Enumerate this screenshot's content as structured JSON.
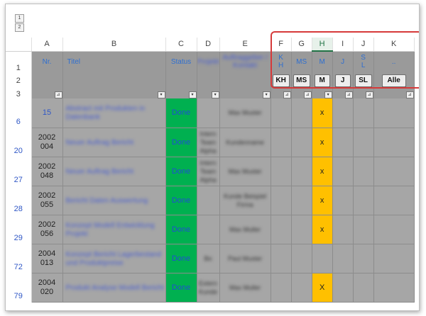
{
  "outline_buttons": [
    "1",
    "2"
  ],
  "columns": [
    {
      "letter": "A"
    },
    {
      "letter": "B"
    },
    {
      "letter": "C"
    },
    {
      "letter": "D"
    },
    {
      "letter": "E"
    },
    {
      "letter": "F"
    },
    {
      "letter": "G"
    },
    {
      "letter": "H"
    },
    {
      "letter": "I"
    },
    {
      "letter": "J"
    },
    {
      "letter": "K"
    }
  ],
  "header_row": {
    "row_num": "1",
    "nr": "Nr.",
    "titel": "Titel",
    "status": "Status",
    "d_label_blurred": "Projekt",
    "e_label_blurred": "Auftraggeber / Kontakt",
    "f_label": "K\nH",
    "g_label": "MS",
    "h_label": "M",
    "i_label": "J",
    "j_label": "S\nL",
    "k_label": ".."
  },
  "button_row": {
    "row_num": "2",
    "buttons": [
      "KH",
      "MS",
      "M",
      "J",
      "SL",
      "Alle"
    ]
  },
  "filter_row": {
    "row_num": "3"
  },
  "rows": [
    {
      "row_num": "6",
      "nr": "15",
      "titel": "Abstract mit Produkten in Datenbank",
      "status": "Done",
      "d": "",
      "e": "Max Muster",
      "x": "x"
    },
    {
      "row_num": "20",
      "nr": "2002\n004",
      "titel": "Neuer Auftrag Bericht",
      "status": "Done",
      "d": "Intern Team Alpha",
      "e": "Kundenname",
      "x": "x"
    },
    {
      "row_num": "27",
      "nr": "2002\n048",
      "titel": "Neuer Auftrag Bericht",
      "status": "Done",
      "d": "Intern Team Alpha",
      "e": "Max Muster",
      "x": "x"
    },
    {
      "row_num": "28",
      "nr": "2002\n055",
      "titel": "Bericht Daten Auswertung",
      "status": "Done",
      "d": "",
      "e": "Kunde Beispiel Firma",
      "x": "x"
    },
    {
      "row_num": "29",
      "nr": "2002\n056",
      "titel": "Konzept Modell Entwicklung Projekt",
      "status": "Done",
      "d": "",
      "e": "Max Muller",
      "x": "x"
    },
    {
      "row_num": "72",
      "nr": "2004\n013",
      "titel": "Konzept Bericht Lagerbestand und Produktpreise",
      "status": "Done",
      "d": "Bo",
      "e": "Paul Muster",
      "x": ""
    },
    {
      "row_num": "79",
      "nr": "2004\n020",
      "titel": "Produkt Analyse Modell Bericht",
      "status": "Done",
      "d": "Extern Kunde",
      "e": "Max Muller",
      "x": "X"
    }
  ]
}
